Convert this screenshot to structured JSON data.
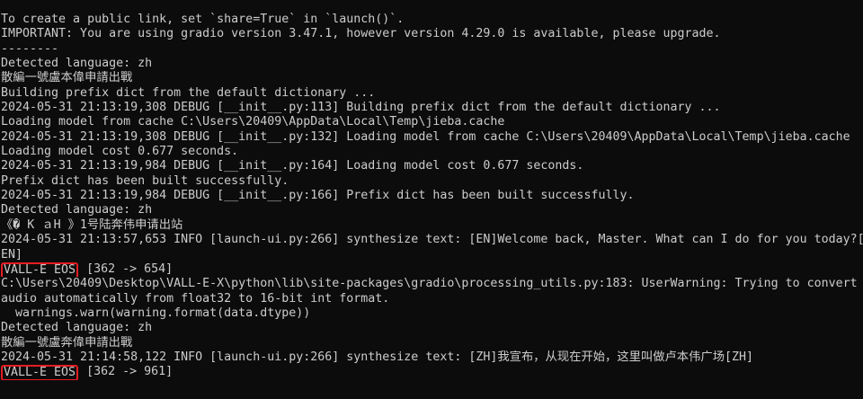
{
  "terminal": {
    "lines": [
      "To create a public link, set `share=True` in `launch()`.",
      "IMPORTANT: You are using gradio version 3.47.1, however version 4.29.0 is available, please upgrade.",
      "--------",
      "Detected language: zh",
      "散編一號盧本偉申請出戰",
      "Building prefix dict from the default dictionary ...",
      "2024-05-31 21:13:19,308 DEBUG [__init__.py:113] Building prefix dict from the default dictionary ...",
      "Loading model from cache C:\\Users\\20409\\AppData\\Local\\Temp\\jieba.cache",
      "2024-05-31 21:13:19,308 DEBUG [__init__.py:132] Loading model from cache C:\\Users\\20409\\AppData\\Local\\Temp\\jieba.cache",
      "Loading model cost 0.677 seconds.",
      "2024-05-31 21:13:19,984 DEBUG [__init__.py:164] Loading model cost 0.677 seconds.",
      "Prefix dict has been built successfully.",
      "2024-05-31 21:13:19,984 DEBUG [__init__.py:166] Prefix dict has been built successfully.",
      "Detected language: zh",
      "《� K ａH 》1号陆奔伟申请出站",
      "2024-05-31 21:13:57,653 INFO [launch-ui.py:266] synthesize text: [EN]Welcome back, Master. What can I do for you today?[",
      "EN]",
      null,
      "C:\\Users\\20409\\Desktop\\VALL-E-X\\python\\lib\\site-packages\\gradio\\processing_utils.py:183: UserWarning: Trying to convert",
      "audio automatically from float32 to 16-bit int format.",
      "  warnings.warn(warning.format(data.dtype))",
      "Detected language: zh",
      "散編一號盧奔偉申請出戰",
      "2024-05-31 21:14:58,122 INFO [launch-ui.py:266] synthesize text: [ZH]我宣布，从现在开始，这里叫做卢本伟广场[ZH]",
      null
    ],
    "eos_1": {
      "label": "VALL-E EOS",
      "suffix": " [362 -> 654]"
    },
    "eos_2": {
      "label": "VALL-E EOS",
      "suffix": " [362 -> 961]"
    },
    "accent_color": "#e51c23",
    "text_color": "#cccccc",
    "background_color": "#0c0c0c"
  }
}
